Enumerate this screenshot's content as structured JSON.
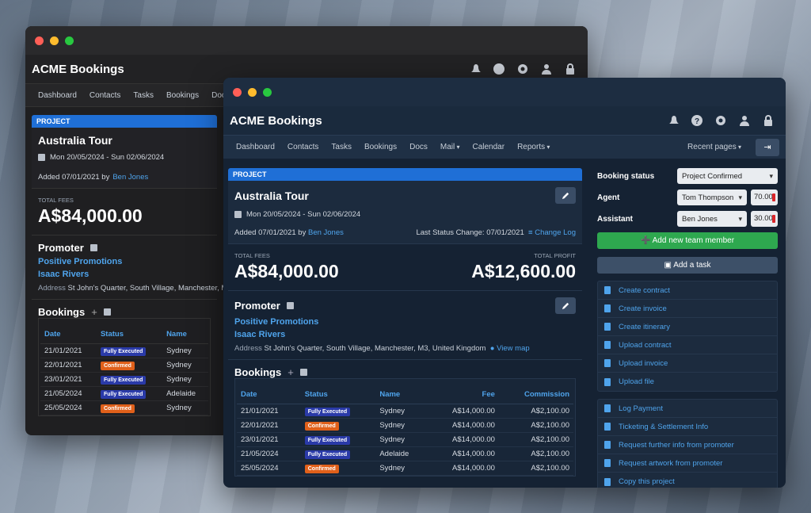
{
  "app": {
    "title": "ACME Bookings"
  },
  "nav": {
    "items": [
      "Dashboard",
      "Contacts",
      "Tasks",
      "Bookings",
      "Docs",
      "Mail",
      "Calendar",
      "Reports"
    ],
    "back_items": [
      "Dashboard",
      "Contacts",
      "Tasks",
      "Bookings",
      "Docs"
    ],
    "recent_pages": "Recent pages"
  },
  "project": {
    "header": "PROJECT",
    "title": "Australia Tour",
    "dates": "Mon 20/05/2024 - Sun 02/06/2024",
    "added_prefix": "Added 07/01/2021 by",
    "added_by": "Ben Jones",
    "last_status": "Last Status Change: 07/01/2021",
    "change_log": "Change Log",
    "total_fees_label": "TOTAL FEES",
    "total_fees": "A$84,000.00",
    "total_profit_label": "TOTAL PROFIT",
    "total_profit": "A$12,600.00"
  },
  "promoter": {
    "title": "Promoter",
    "company": "Positive Promotions",
    "contact": "Isaac Rivers",
    "address_label": "Address",
    "address": "St John's Quarter, South Village, Manchester, M3, United Kingdom",
    "address_back": "St John's Quarter, South Village, Manchester, M",
    "view_map": "View map"
  },
  "bookings": {
    "title": "Bookings",
    "columns": {
      "date": "Date",
      "status": "Status",
      "name": "Name",
      "fee": "Fee",
      "commission": "Commission"
    },
    "rows": [
      {
        "date": "21/01/2021",
        "status": "Fully Executed",
        "name": "Sydney",
        "fee": "A$14,000.00",
        "commission": "A$2,100.00"
      },
      {
        "date": "22/01/2021",
        "status": "Confirmed",
        "name": "Sydney",
        "fee": "A$14,000.00",
        "commission": "A$2,100.00"
      },
      {
        "date": "23/01/2021",
        "status": "Fully Executed",
        "name": "Sydney",
        "fee": "A$14,000.00",
        "commission": "A$2,100.00"
      },
      {
        "date": "21/05/2024",
        "status": "Fully Executed",
        "name": "Adelaide",
        "fee": "A$14,000.00",
        "commission": "A$2,100.00"
      },
      {
        "date": "25/05/2024",
        "status": "Confirmed",
        "name": "Sydney",
        "fee": "A$14,000.00",
        "commission": "A$2,100.00"
      }
    ]
  },
  "sidebar": {
    "booking_status_label": "Booking status",
    "booking_status": "Project Confirmed",
    "agent_label": "Agent",
    "agent": "Tom Thompson",
    "agent_pct": "70.00",
    "assistant_label": "Assistant",
    "assistant": "Ben Jones",
    "assistant_pct": "30.00",
    "add_member": "Add new team member",
    "add_task": "Add a task",
    "doc_actions": [
      "Create contract",
      "Create invoice",
      "Create itinerary",
      "Upload contract",
      "Upload invoice",
      "Upload file"
    ],
    "other_actions": [
      "Log Payment",
      "Ticketing & Settlement Info",
      "Request further info from promoter",
      "Request artwork from promoter",
      "Copy this project"
    ]
  },
  "colors": {
    "accent": "#1f6fd6",
    "link": "#4fa4ec",
    "green": "#2ea84f",
    "fully_executed": "#2a3aa8",
    "confirmed": "#e0601a"
  }
}
